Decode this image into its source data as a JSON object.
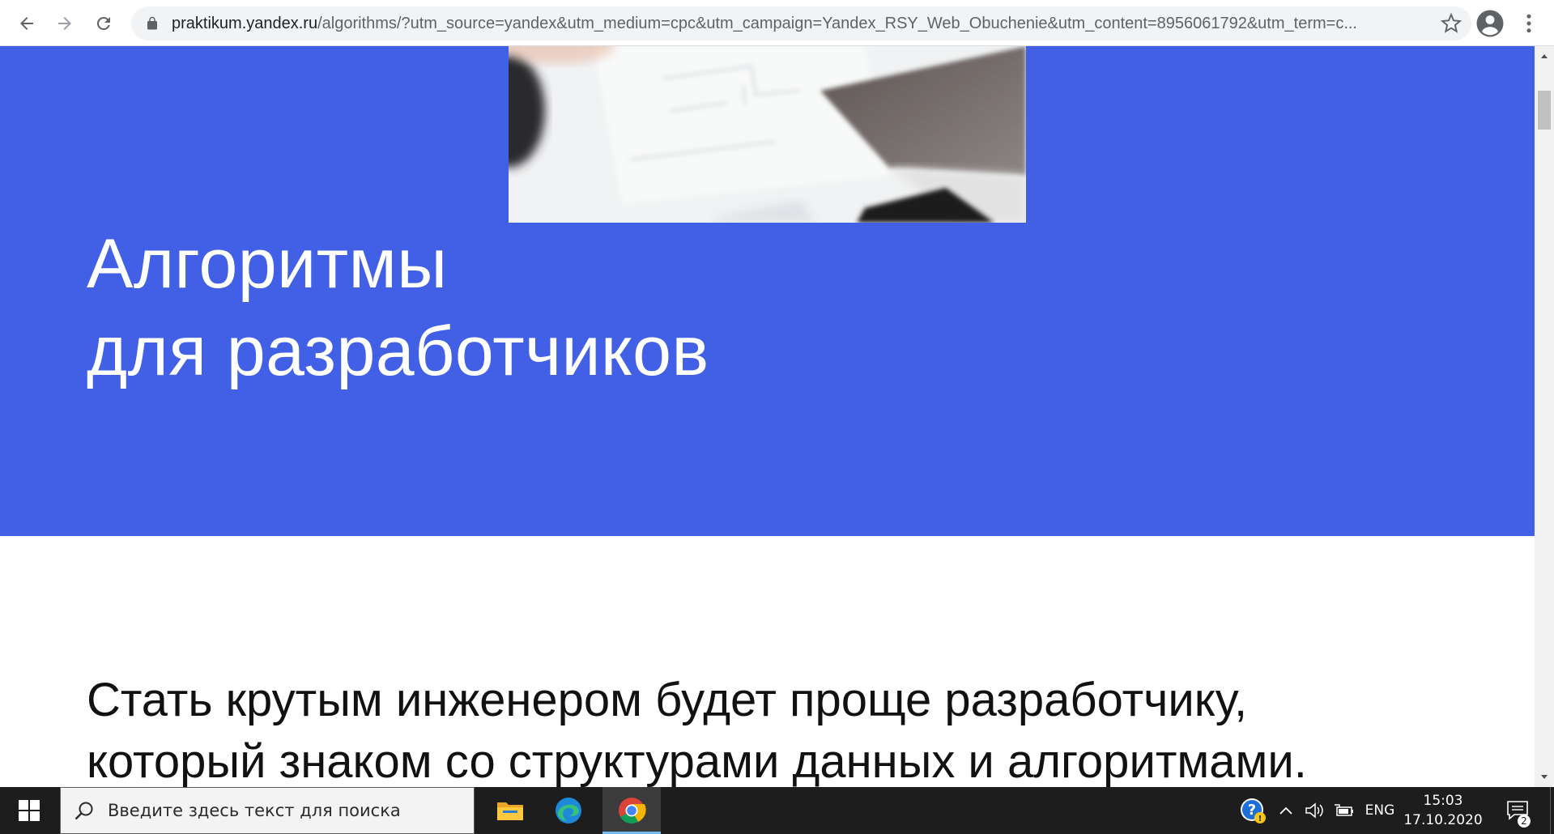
{
  "browser": {
    "url_host": "praktikum.yandex.ru",
    "url_rest": "/algorithms/?utm_source=yandex&utm_medium=cpc&utm_campaign=Yandex_RSY_Web_Obuchenie&utm_content=8956061792&utm_term=c...",
    "icons": {
      "back": "arrow-left-icon",
      "forward": "arrow-right-icon",
      "reload": "reload-icon",
      "lock": "lock-icon",
      "bookmark": "star-icon",
      "profile": "account-circle-icon",
      "menu": "more-vert-icon"
    }
  },
  "page": {
    "hero": {
      "title_line1": "Алгоритмы",
      "title_line2": "для разработчиков",
      "background": "#4160e5"
    },
    "intro": {
      "line1": "Стать крутым инженером будет проще разработчику,",
      "line2": "который знаком со структурами данных и алгоритмами."
    }
  },
  "taskbar": {
    "search_placeholder": "Введите здесь текст для поиска",
    "apps": [
      "file-explorer-icon",
      "edge-icon",
      "chrome-icon"
    ],
    "tray": {
      "language": "ENG",
      "time": "15:03",
      "date": "17.10.2020",
      "notification_count": "2"
    }
  }
}
